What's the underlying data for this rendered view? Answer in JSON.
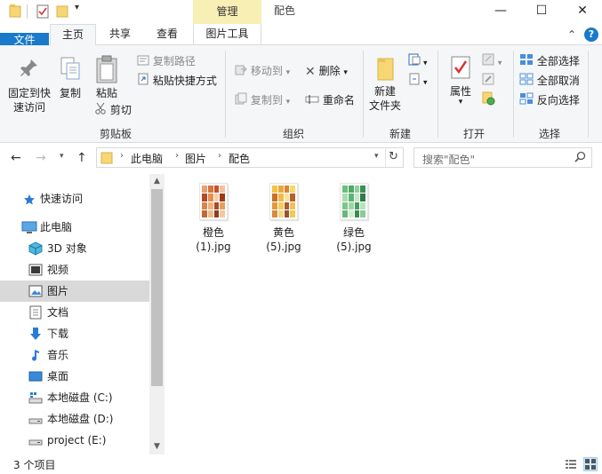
{
  "window": {
    "title": "配色",
    "context_tab": "管理",
    "minimize": "—",
    "maximize": "☐",
    "close": "✕"
  },
  "tabs": {
    "file": "文件",
    "home": "主页",
    "share": "共享",
    "view": "查看",
    "picture_tools": "图片工具"
  },
  "ribbon": {
    "clipboard": {
      "pin": "固定到快\n速访问",
      "pin_l1": "固定到快",
      "pin_l2": "速访问",
      "copy": "复制",
      "paste": "粘贴",
      "copy_path": "复制路径",
      "paste_shortcut": "粘贴快捷方式",
      "cut": "剪切",
      "label": "剪贴板"
    },
    "organize": {
      "move_to": "移动到",
      "copy_to": "复制到",
      "delete": "删除",
      "rename": "重命名",
      "label": "组织"
    },
    "new": {
      "new_folder_l1": "新建",
      "new_folder_l2": "文件夹",
      "label": "新建"
    },
    "open": {
      "properties": "属性",
      "label": "打开"
    },
    "select": {
      "select_all": "全部选择",
      "select_none": "全部取消",
      "invert": "反向选择",
      "label": "选择"
    }
  },
  "address": {
    "crumbs": [
      "此电脑",
      "图片",
      "配色"
    ],
    "search_placeholder": "搜索\"配色\""
  },
  "nav": {
    "items": [
      {
        "label": "快速访问",
        "icon": "star-icon"
      },
      {
        "label": "此电脑",
        "icon": "computer-icon"
      },
      {
        "label": "3D 对象",
        "icon": "cube-icon"
      },
      {
        "label": "视频",
        "icon": "video-icon"
      },
      {
        "label": "图片",
        "icon": "pictures-icon"
      },
      {
        "label": "文档",
        "icon": "document-icon"
      },
      {
        "label": "下载",
        "icon": "download-icon"
      },
      {
        "label": "音乐",
        "icon": "music-icon"
      },
      {
        "label": "桌面",
        "icon": "desktop-icon"
      },
      {
        "label": "本地磁盘 (C:)",
        "icon": "drive-icon"
      },
      {
        "label": "本地磁盘 (D:)",
        "icon": "drive-icon"
      },
      {
        "label": "project (E:)",
        "icon": "drive-icon"
      }
    ]
  },
  "files": [
    {
      "name_l1": "橙色",
      "name_l2": "(1).jpg",
      "palette": [
        "#e8a070",
        "#d9743c",
        "#c7512a",
        "#f2c29c",
        "#b8462a",
        "#e38f4f",
        "#f5d0a8",
        "#9c3a1f",
        "#d8864a",
        "#f0b27a",
        "#a84a2a",
        "#e0a060",
        "#c26838",
        "#e9bd8a",
        "#8f3a22",
        "#f3c89b"
      ]
    },
    {
      "name_l1": "黄色",
      "name_l2": "(5).jpg",
      "palette": [
        "#f4c542",
        "#e8a93a",
        "#d9862f",
        "#f7d96b",
        "#c9702a",
        "#efb94a",
        "#f9e39a",
        "#b8602a",
        "#e39a3a",
        "#f4cc5a",
        "#a85a30",
        "#f0c060",
        "#d88a40",
        "#f5d880",
        "#985030",
        "#f2c850"
      ]
    },
    {
      "name_l1": "绿色",
      "name_l2": "(5).jpg",
      "palette": [
        "#6bbf7a",
        "#4fa865",
        "#8fd19b",
        "#3a8f55",
        "#a8dcb0",
        "#5cb472",
        "#c4e8c8",
        "#2f7a48",
        "#7cc78a",
        "#9bd6a4",
        "#4a9a60",
        "#b6e2bc",
        "#68b878",
        "#d0eed4",
        "#3f8a54",
        "#88cc95"
      ]
    }
  ],
  "status": {
    "count": "3 个项目"
  }
}
